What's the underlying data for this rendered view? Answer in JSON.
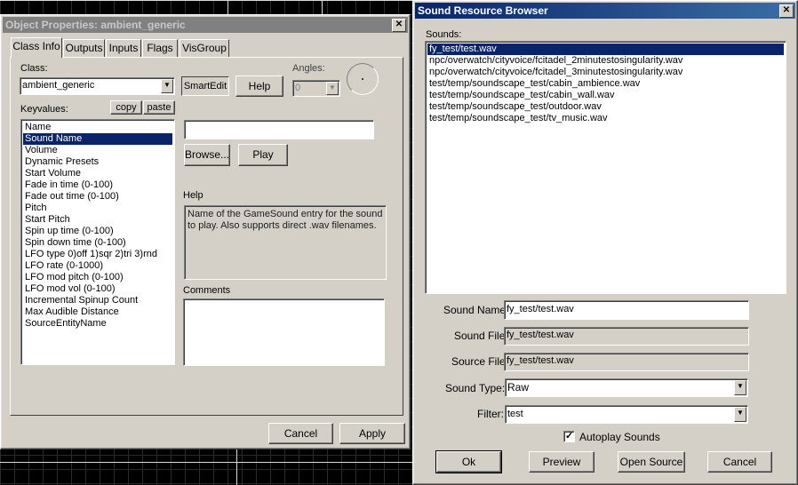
{
  "object_props": {
    "title": "Object Properties: ambient_generic",
    "tabs": [
      "Class Info",
      "Outputs",
      "Inputs",
      "Flags",
      "VisGroup"
    ],
    "class_label": "Class:",
    "class_value": "ambient_generic",
    "smartedit_label": "SmartEdit",
    "help_button": "Help",
    "angles_label": "Angles:",
    "angles_value": "0",
    "keyvalues_label": "Keyvalues:",
    "copy_label": "copy",
    "paste_label": "paste",
    "keyvalues": [
      "Name",
      "Sound Name",
      "Volume",
      "Dynamic Presets",
      "Start Volume",
      "Fade in time (0-100)",
      "Fade out time (0-100)",
      "Pitch",
      "Start Pitch",
      "Spin up time (0-100)",
      "Spin down time (0-100)",
      "LFO type 0)off 1)sqr 2)tri 3)rnd",
      "LFO rate (0-1000)",
      "LFO mod pitch (0-100)",
      "LFO mod vol (0-100)",
      "Incremental Spinup Count",
      "Max Audible Distance",
      "SourceEntityName"
    ],
    "selected_index": 1,
    "value_input": "",
    "browse_label": "Browse...",
    "play_label": "Play",
    "help_label": "Help",
    "help_text": "Name of the GameSound entry for the sound to play. Also supports direct .wav filenames.",
    "comments_label": "Comments",
    "comments_value": "",
    "cancel_label": "Cancel",
    "apply_label": "Apply"
  },
  "sound_browser": {
    "title": "Sound Resource Browser",
    "sounds_label": "Sounds:",
    "sounds": [
      "fy_test/test.wav",
      "npc/overwatch/cityvoice/fcitadel_2minutestosingularity.wav",
      "npc/overwatch/cityvoice/fcitadel_3minutestosingularity.wav",
      "test/temp/soundscape_test/cabin_ambience.wav",
      "test/temp/soundscape_test/cabin_wall.wav",
      "test/temp/soundscape_test/outdoor.wav",
      "test/temp/soundscape_test/tv_music.wav"
    ],
    "selected_index": 0,
    "sound_name_label": "Sound Name:",
    "sound_name_value": "fy_test/test.wav",
    "sound_file_label": "Sound File:",
    "sound_file_value": "fy_test/test.wav",
    "source_file_label": "Source File:",
    "source_file_value": "fy_test/test.wav",
    "sound_type_label": "Sound Type:",
    "sound_type_value": "Raw",
    "filter_label": "Filter:",
    "filter_value": "test",
    "autoplay_label": "Autoplay Sounds",
    "autoplay_checked": true,
    "ok_label": "Ok",
    "preview_label": "Preview",
    "open_source_label": "Open Source",
    "cancel_label": "Cancel"
  },
  "icons": {
    "close": "close-icon",
    "dropdown": "chevron-down-icon",
    "check": "checkmark-icon"
  }
}
